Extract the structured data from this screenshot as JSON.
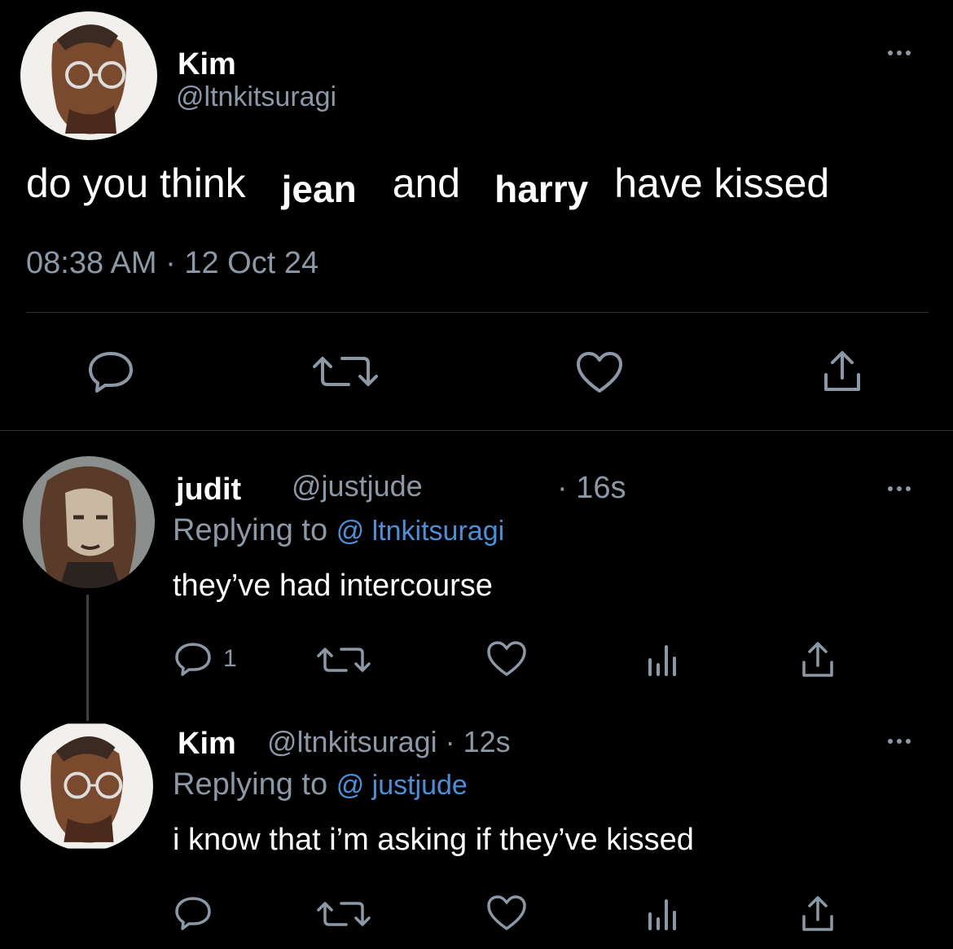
{
  "main_tweet": {
    "author_name": "Kim",
    "author_handle": "@ltnkitsuragi",
    "text_parts": [
      "do you think",
      "jean",
      "and",
      "harry",
      "have kissed"
    ],
    "timestamp": "08:38 AM · 12 Oct 24"
  },
  "reply1": {
    "author_name": "judit",
    "author_handle": "@justjude",
    "time": "· 16s",
    "replying_prefix": "Replying to",
    "replying_handle": "@ ltnkitsuragi",
    "text": "they’ve had intercourse",
    "reply_count": "1"
  },
  "reply2": {
    "author_name": "Kim",
    "author_handle": "@ltnkitsuragi · 12s",
    "replying_prefix": "Replying to",
    "replying_handle": "@ justjude",
    "text": "i know that i’m asking if they’ve kissed"
  },
  "colors": {
    "background": "#000000",
    "muted": "#8b98a5",
    "link": "#4a90d9",
    "divider": "#2f3336"
  }
}
